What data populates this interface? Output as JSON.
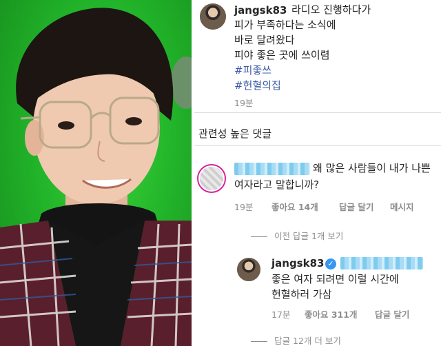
{
  "post": {
    "username": "jangsk83",
    "caption_lines": [
      "라디오 진행하다가",
      "피가 부족하다는 소식에",
      "바로 달려왔다",
      "피야 좋은 곳에 쓰이렴"
    ],
    "hashtags": [
      "#피좋쓰",
      "#헌혈의집"
    ],
    "time": "19분"
  },
  "comments_header": "관련성 높은 댓글",
  "comment": {
    "text_line1": "왜 많은 사람들이 내가 나쁜",
    "text_line2": "여자라고 말합니까?",
    "time": "19분",
    "likes": "좋아요 14개",
    "reply": "답글 달기",
    "message": "메시지"
  },
  "previous_replies": "이전 답글 1개 보기",
  "reply": {
    "username": "jangsk83",
    "verified_glyph": "✓",
    "text_line1": "좋은 여자 되려면 이럴 시간에",
    "text_line2": "헌혈하러 가삼",
    "time": "17분",
    "likes": "좋아요 311개",
    "reply_action": "답글 달기"
  },
  "more_replies": "답글 12개 더 보기",
  "colors": {
    "hashtag": "#3b5aa6",
    "verified": "#3897f0",
    "meta": "#8e8e8e",
    "background_green": "#22b52a"
  },
  "icons": [
    "verified-badge-icon"
  ]
}
